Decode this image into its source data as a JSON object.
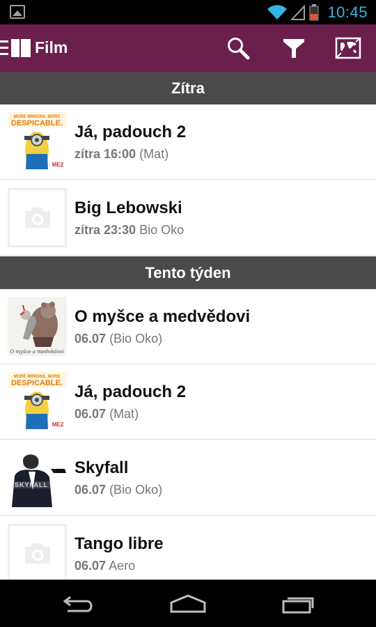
{
  "status_bar": {
    "time": "10:45",
    "icons": [
      "image-notification-icon",
      "wifi-icon",
      "signal-icon",
      "battery-icon"
    ],
    "accent_color": "#33b5e5"
  },
  "action_bar": {
    "title": "Film",
    "background_color": "#6b1f4d",
    "actions": [
      "search-icon",
      "filter-icon",
      "map-icon"
    ]
  },
  "sections": [
    {
      "header": "Zítra",
      "items": [
        {
          "title": "Já, padouch 2",
          "when": "zítra 16:00",
          "venue": "(Mat)",
          "poster": "despicable-me-2-poster"
        },
        {
          "title": "Big Lebowski",
          "when": "zítra 23:30",
          "venue": "Bio Oko",
          "poster": "placeholder-camera-icon"
        }
      ]
    },
    {
      "header": "Tento týden",
      "items": [
        {
          "title": "O myšce a medvědovi",
          "when": "06.07",
          "venue": "(Bio Oko)",
          "poster": "ernest-celestine-poster"
        },
        {
          "title": "Já, padouch 2",
          "when": "06.07",
          "venue": "(Mat)",
          "poster": "despicable-me-2-poster"
        },
        {
          "title": "Skyfall",
          "when": "06.07",
          "venue": "(Bio Oko)",
          "poster": "skyfall-poster"
        },
        {
          "title": "Tango libre",
          "when": "06.07",
          "venue": "Aero",
          "poster": "placeholder-camera-icon"
        }
      ]
    }
  ],
  "posters": {
    "despicable_text_top": "MORE MINIONS. MORE",
    "despicable_text": "DESPICABLE.",
    "despicable_me2": "ME2",
    "ernest_caption": "O myšce a medvědovi",
    "skyfall_text": "SKYFALL"
  },
  "nav_bar": {
    "buttons": [
      "back-icon",
      "home-icon",
      "recent-apps-icon"
    ]
  }
}
